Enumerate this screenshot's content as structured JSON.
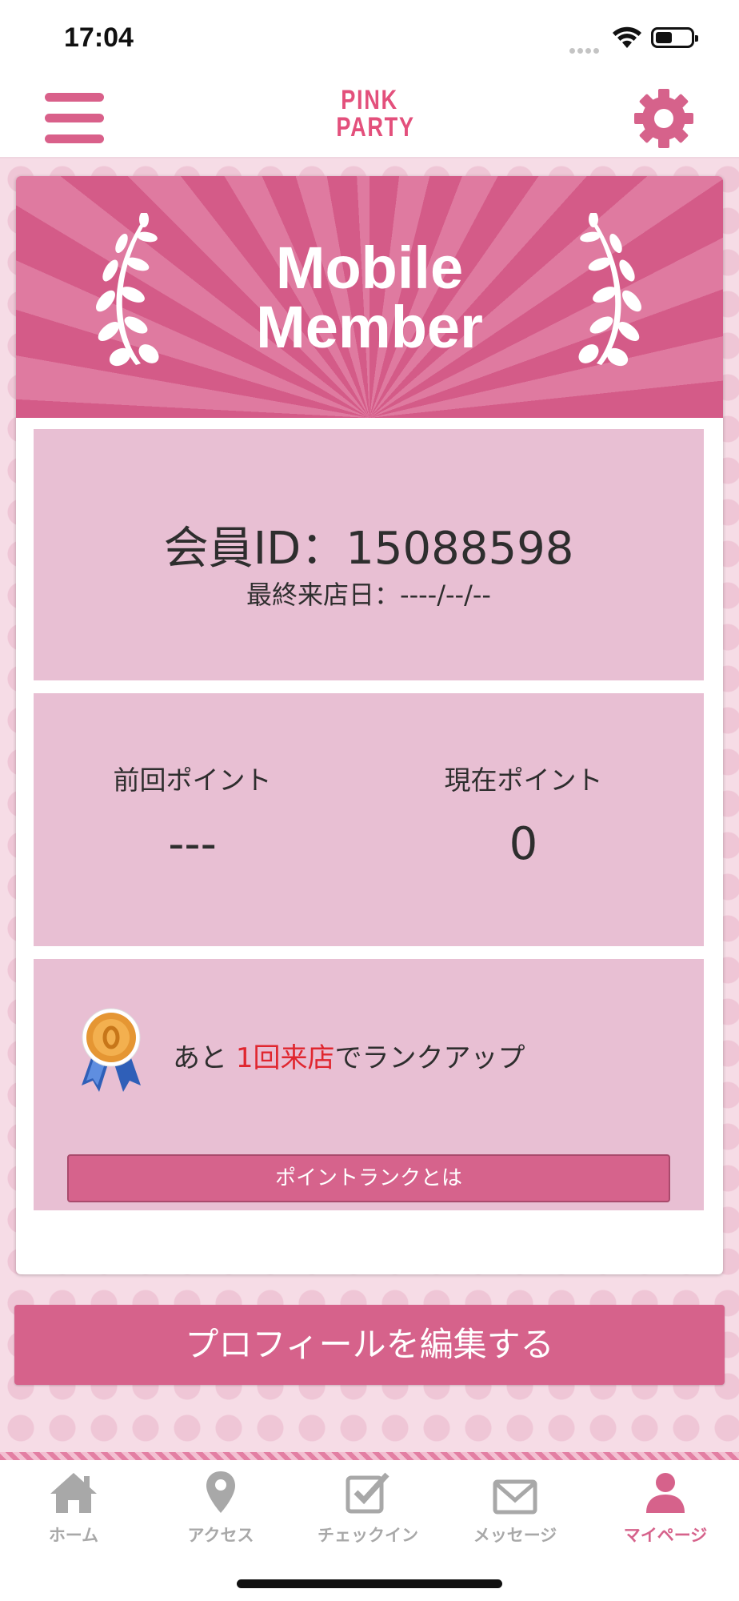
{
  "status_bar": {
    "time": "17:04"
  },
  "header": {
    "logo_line1": "PINK",
    "logo_line2": "PARTY",
    "brand_color": "#e3507c"
  },
  "banner": {
    "title_line1": "Mobile",
    "title_line2": "Member"
  },
  "member": {
    "id_text": "会員ID：15088598",
    "last_visit": "最終来店日：----/--/--"
  },
  "points": {
    "previous_label": "前回ポイント",
    "previous_value": "---",
    "current_label": "現在ポイント",
    "current_value": "0"
  },
  "rank": {
    "prefix": "あと ",
    "highlight": "1回来店",
    "suffix": "でランクアップ",
    "button_label": "ポイントランクとは"
  },
  "edit_profile_label": "プロフィールを編集する",
  "tabs": [
    {
      "label": "ホーム",
      "icon": "home-icon"
    },
    {
      "label": "アクセス",
      "icon": "map-pin-icon"
    },
    {
      "label": "チェックイン",
      "icon": "checkin-icon"
    },
    {
      "label": "メッセージ",
      "icon": "mail-icon"
    },
    {
      "label": "マイページ",
      "icon": "user-icon",
      "active": true
    }
  ],
  "colors": {
    "accent": "#d6628b",
    "highlight": "#e0262f",
    "panel": "#e8bfd3",
    "inactive_tab": "#a8a8a8"
  }
}
